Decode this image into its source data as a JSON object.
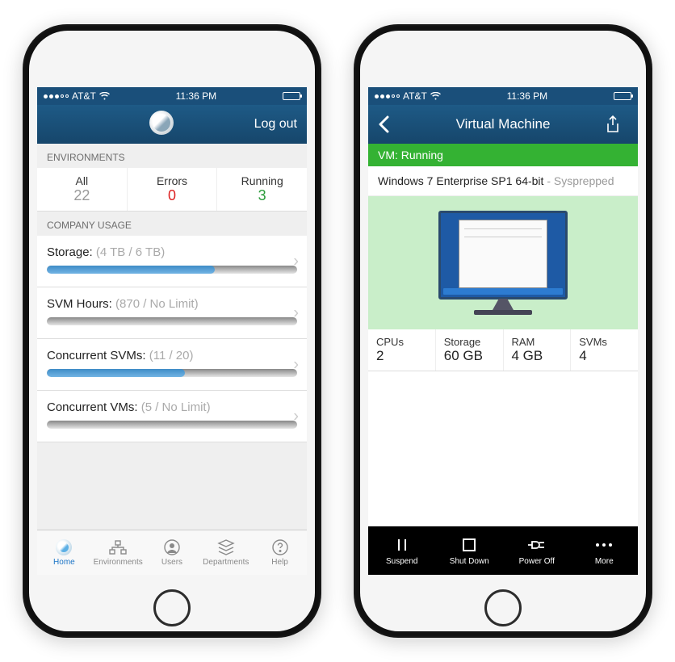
{
  "statusbar": {
    "carrier": "AT&T",
    "time": "11:36 PM"
  },
  "left": {
    "header": {
      "logout": "Log out"
    },
    "env_section_label": "ENVIRONMENTS",
    "env": {
      "all": {
        "label": "All",
        "value": "22"
      },
      "errors": {
        "label": "Errors",
        "value": "0"
      },
      "running": {
        "label": "Running",
        "value": "3"
      }
    },
    "usage_section_label": "COMPANY USAGE",
    "usage": [
      {
        "label": "Storage:",
        "value": "(4 TB / 6 TB)",
        "pct": 67
      },
      {
        "label": "SVM Hours:",
        "value": "(870 / No Limit)",
        "pct": 0
      },
      {
        "label": "Concurrent SVMs:",
        "value": "(11 / 20)",
        "pct": 55
      },
      {
        "label": "Concurrent VMs:",
        "value": "(5 / No Limit)",
        "pct": 0
      }
    ],
    "tabs": {
      "home": "Home",
      "environments": "Environments",
      "users": "Users",
      "departments": "Departments",
      "help": "Help"
    }
  },
  "right": {
    "header": {
      "title": "Virtual Machine"
    },
    "status": "VM: Running",
    "vm_name": "Windows 7 Enterprise SP1 64-bit",
    "vm_suffix": " - Sysprepped",
    "specs": {
      "cpus": {
        "label": "CPUs",
        "value": "2"
      },
      "storage": {
        "label": "Storage",
        "value": "60 GB"
      },
      "ram": {
        "label": "RAM",
        "value": "4 GB"
      },
      "svms": {
        "label": "SVMs",
        "value": "4"
      }
    },
    "actions": {
      "suspend": "Suspend",
      "shutdown": "Shut Down",
      "poweroff": "Power Off",
      "more": "More"
    }
  }
}
